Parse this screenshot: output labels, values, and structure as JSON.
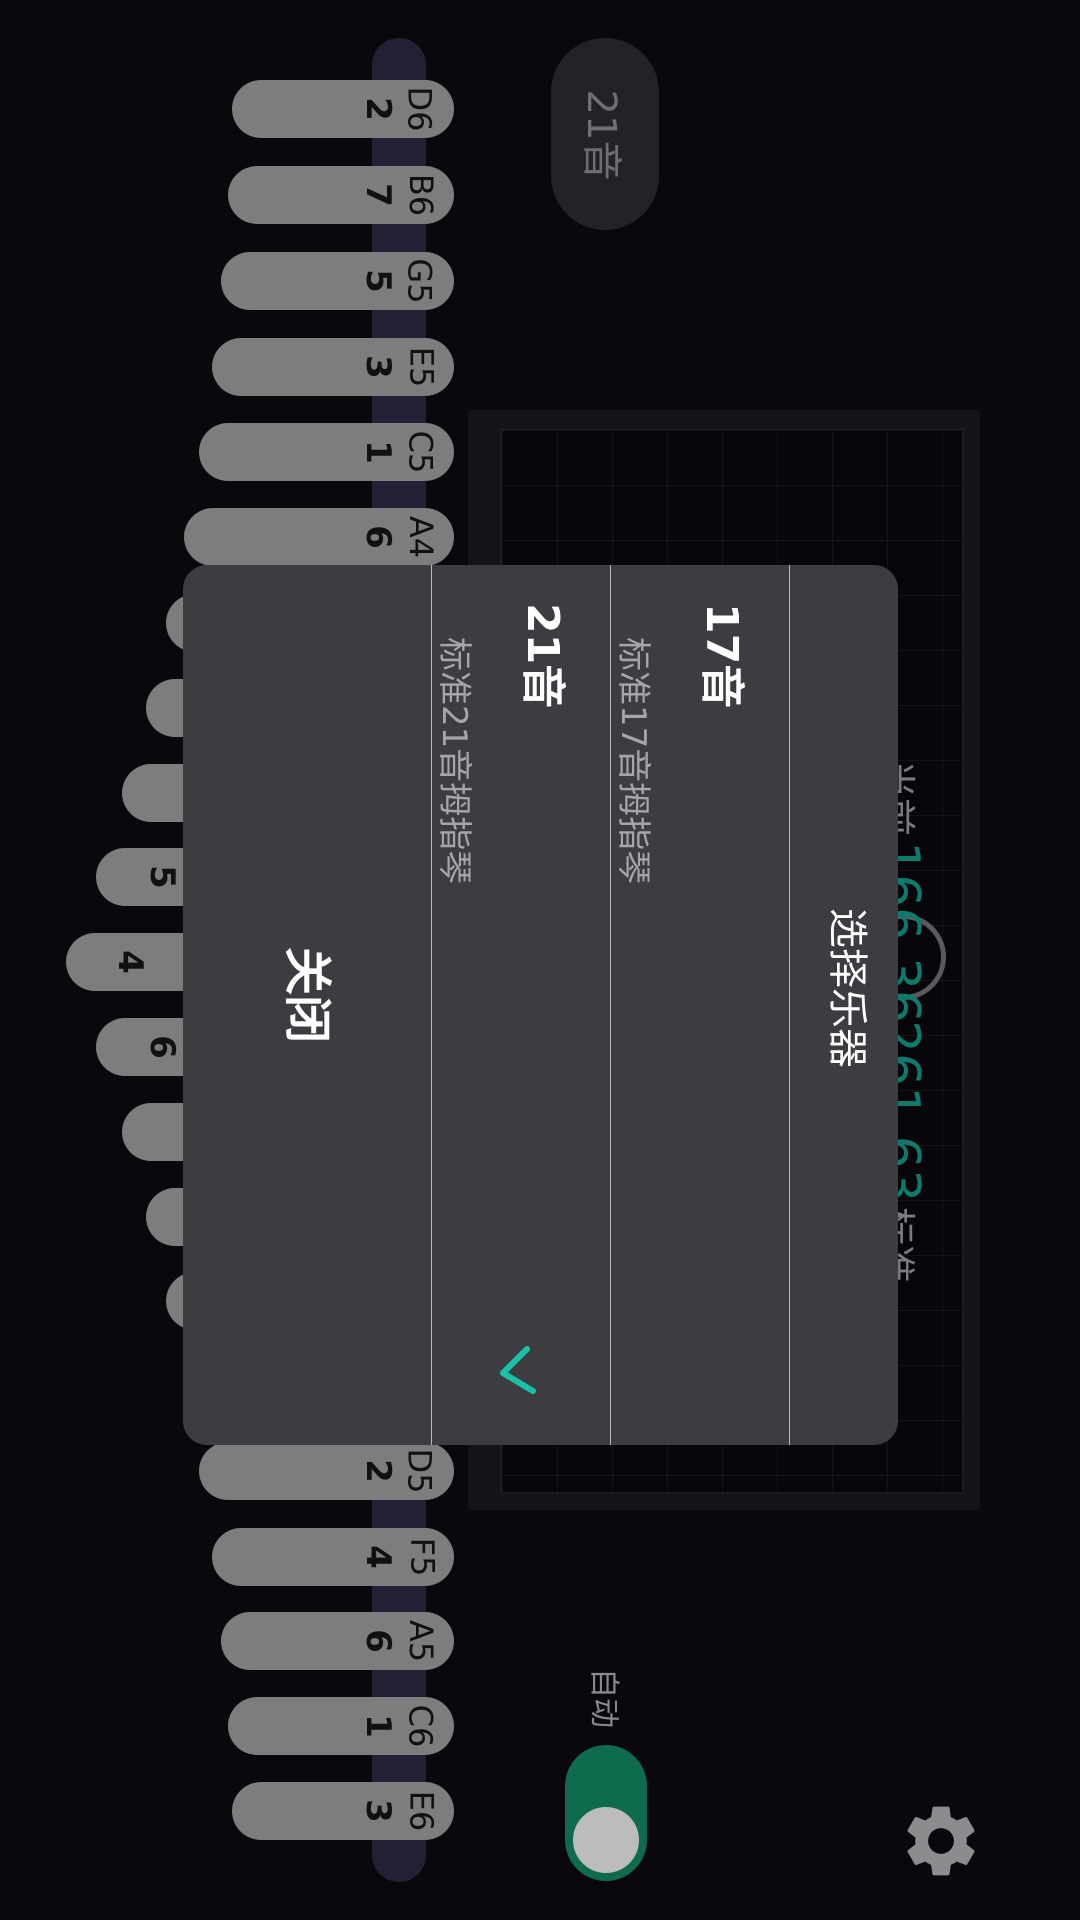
{
  "mode_pill": {
    "label": "21音"
  },
  "frequency": {
    "current_label": "当前",
    "current_value": "166.36",
    "standard_value": "261.63",
    "standard_label": "标准"
  },
  "auto_toggle": {
    "label": "自动",
    "on": true
  },
  "keys_top": [
    {
      "note": "D6",
      "num": "2"
    },
    {
      "note": "B6",
      "num": "7"
    },
    {
      "note": "G5",
      "num": "5"
    },
    {
      "note": "E5",
      "num": "3"
    },
    {
      "note": "C5",
      "num": "1"
    },
    {
      "note": "A4",
      "num": "6"
    }
  ],
  "keys_bottom": [
    {
      "note": "D5",
      "num": "2"
    },
    {
      "note": "F5",
      "num": "4"
    },
    {
      "note": "A5",
      "num": "6"
    },
    {
      "note": "C6",
      "num": "1"
    },
    {
      "note": "E6",
      "num": "3"
    }
  ],
  "keys_hidden_partial": [
    "5",
    "4",
    "6"
  ],
  "dialog": {
    "title": "选择乐器",
    "options": [
      {
        "title": "17音",
        "subtitle": "标准17音拇指琴",
        "selected": false
      },
      {
        "title": "21音",
        "subtitle": "标准21音拇指琴",
        "selected": true
      }
    ],
    "close_label": "关闭",
    "check_color": "#19c2a6"
  },
  "colors": {
    "accent": "#0c7a6d",
    "toggle_on": "#0f6b4e"
  },
  "icons": {
    "settings": "gear-icon",
    "selected": "checkmark-icon"
  }
}
